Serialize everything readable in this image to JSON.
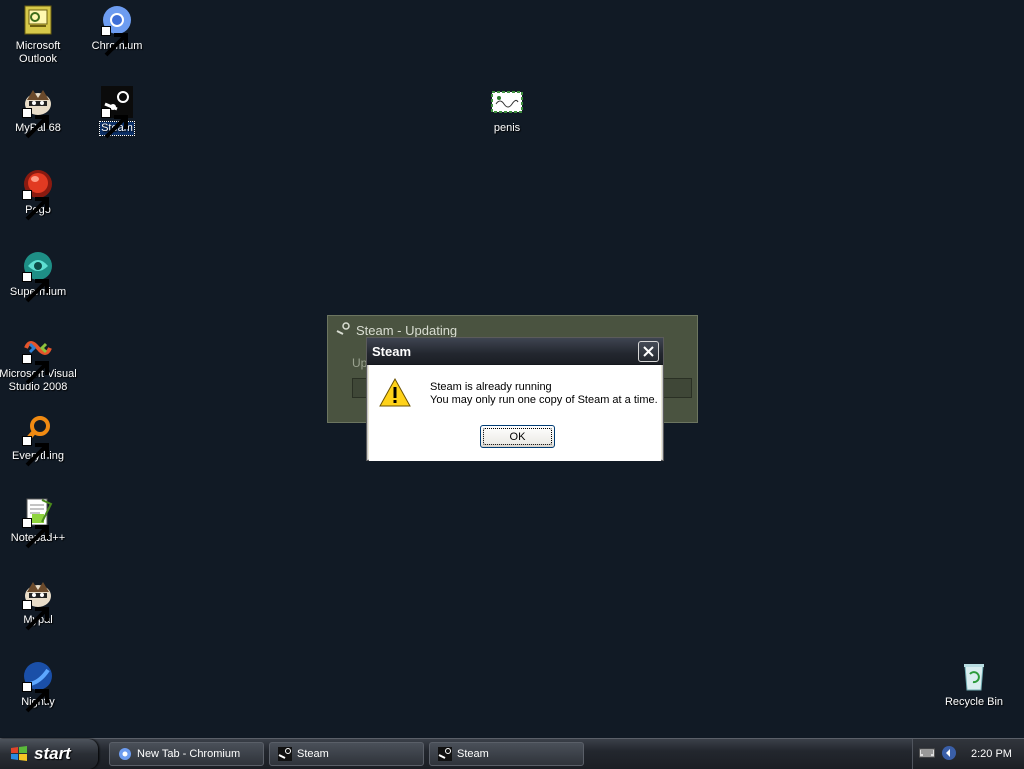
{
  "desktop": {
    "icons": [
      {
        "label": "Microsoft Outlook",
        "icon": "outlook-icon",
        "shortcut": false
      },
      {
        "label": "Chromium",
        "icon": "chromium-icon",
        "shortcut": true
      },
      {
        "label": "MyPal 68",
        "icon": "mypal-icon",
        "shortcut": true
      },
      {
        "label": "Steam",
        "icon": "steam-icon",
        "shortcut": true,
        "selected": true
      },
      {
        "label": "penis",
        "icon": "image-file-icon",
        "shortcut": false
      },
      {
        "label": "Pego",
        "icon": "pego-icon",
        "shortcut": true
      },
      {
        "label": "Supermium",
        "icon": "supermium-icon",
        "shortcut": true
      },
      {
        "label": "Microsoft Visual Studio 2008",
        "icon": "visual-studio-icon",
        "shortcut": true
      },
      {
        "label": "Everything",
        "icon": "everything-icon",
        "shortcut": true
      },
      {
        "label": "Notepad++",
        "icon": "notepadpp-icon",
        "shortcut": true
      },
      {
        "label": "Mypal",
        "icon": "mypal-icon",
        "shortcut": true
      },
      {
        "label": "Nightly",
        "icon": "nightly-icon",
        "shortcut": true
      },
      {
        "label": "Recycle Bin",
        "icon": "recycle-bin-icon",
        "shortcut": false
      }
    ]
  },
  "updating_window": {
    "title": "Steam - Updating",
    "message": "Up"
  },
  "message_box": {
    "title": "Steam",
    "line1": "Steam is already running",
    "line2": "You may only run one copy of Steam at a time.",
    "ok_label": "OK"
  },
  "taskbar": {
    "start_label": "start",
    "buttons": [
      {
        "label": "New Tab - Chromium",
        "icon": "chromium-icon"
      },
      {
        "label": "Steam",
        "icon": "steam-icon"
      },
      {
        "label": "Steam",
        "icon": "steam-icon"
      }
    ],
    "clock": "2:20 PM"
  },
  "colors": {
    "desktop_background": "#111a25",
    "selection": "#0b2f66",
    "dialog_face": "#ece9d8"
  }
}
